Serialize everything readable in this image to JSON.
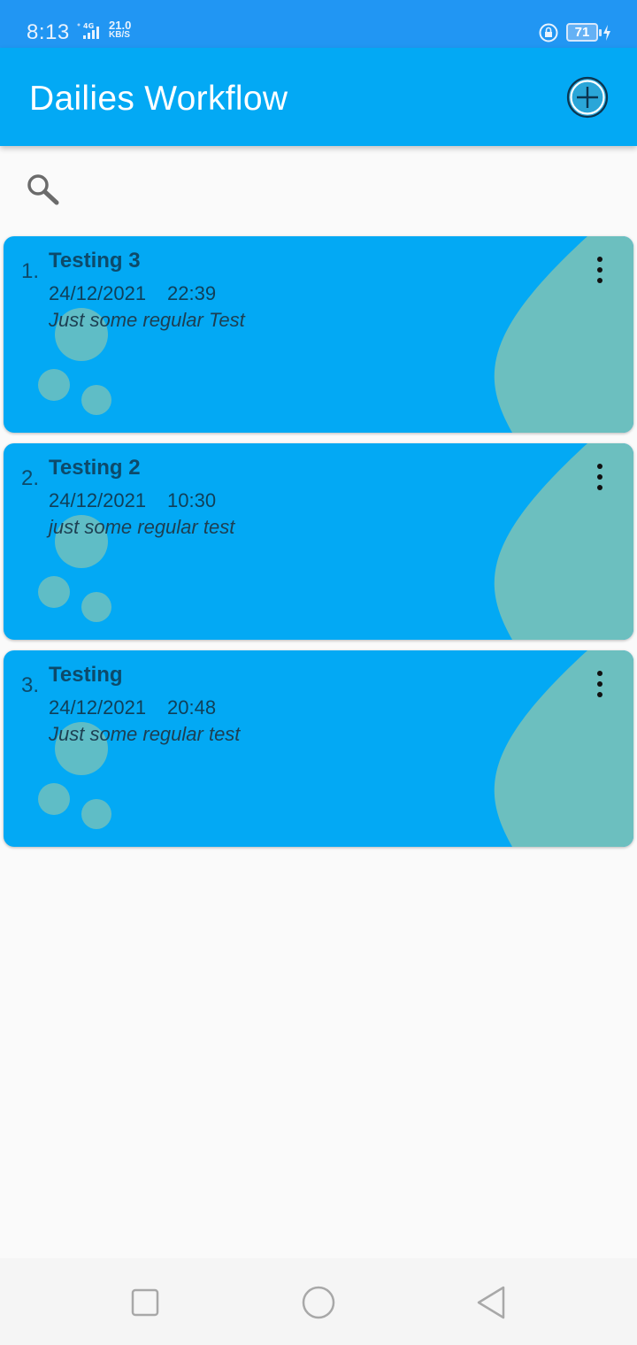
{
  "status_bar": {
    "time": "8:13",
    "network": "4G",
    "speed_value": "21.0",
    "speed_unit": "KB/S",
    "battery": "71"
  },
  "app_bar": {
    "title": "Dailies Workflow",
    "add_icon": "add-circle-icon"
  },
  "search": {
    "icon": "search-icon"
  },
  "workflows": [
    {
      "index": "1.",
      "title": "Testing 3",
      "date": "24/12/2021",
      "time": "22:39",
      "description": "Just some regular Test"
    },
    {
      "index": "2.",
      "title": "Testing 2",
      "date": "24/12/2021",
      "time": "10:30",
      "description": "just some regular test"
    },
    {
      "index": "3.",
      "title": "Testing",
      "date": "24/12/2021",
      "time": "20:48",
      "description": "Just some regular test"
    }
  ],
  "colors": {
    "status_bar": "#2196f3",
    "app_bar": "#03a9f4",
    "card": "#03a9f4",
    "card_decoration": "#6cbfbf",
    "background": "#fafafa"
  },
  "nav_bar": {
    "icons": [
      "recent-apps-icon",
      "home-icon",
      "back-icon"
    ]
  }
}
